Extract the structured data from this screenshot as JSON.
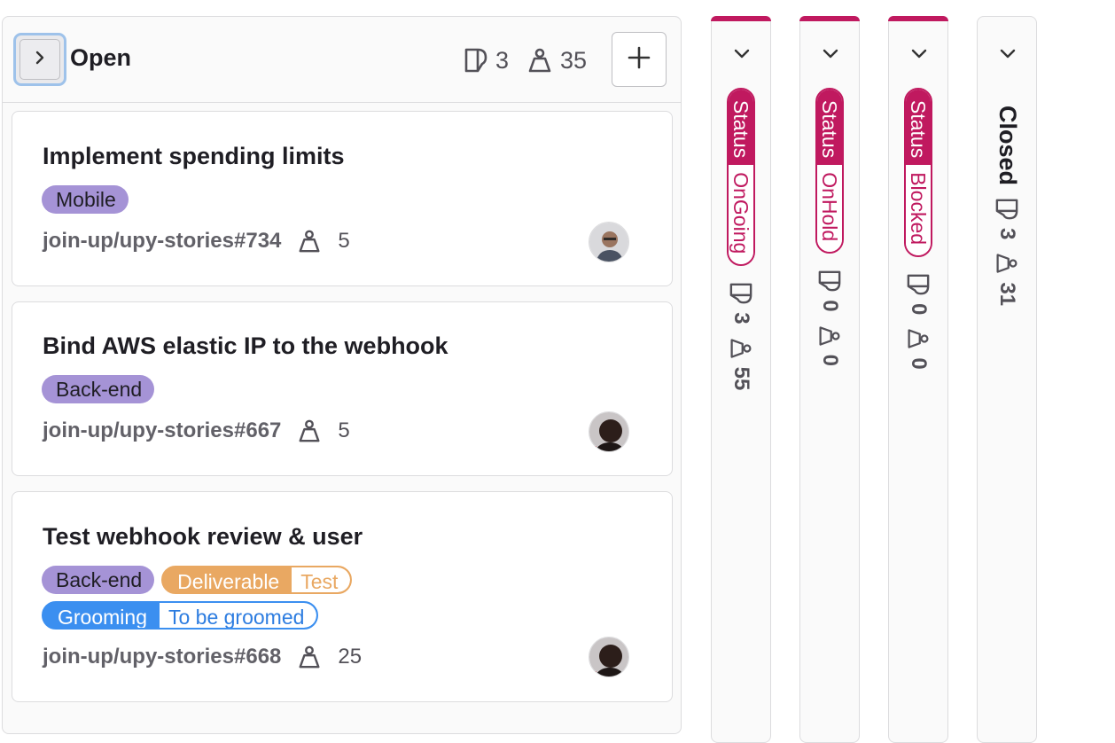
{
  "open_list": {
    "title": "Open",
    "issue_count": "3",
    "weight_total": "35",
    "cards": [
      {
        "title": "Implement spending limits",
        "labels": [
          {
            "text": "Mobile"
          }
        ],
        "reference": "join-up/upy-stories#734",
        "weight": "5"
      },
      {
        "title": "Bind AWS elastic IP to the webhook",
        "labels": [
          {
            "text": "Back-end"
          }
        ],
        "reference": "join-up/upy-stories#667",
        "weight": "5"
      },
      {
        "title": "Test webhook review & user",
        "labels": [
          {
            "text": "Back-end"
          },
          {
            "scope": "Deliverable",
            "value": "Test"
          },
          {
            "scope": "Grooming",
            "value": "To be groomed"
          }
        ],
        "reference": "join-up/upy-stories#668",
        "weight": "25"
      }
    ]
  },
  "collapsed_lists": [
    {
      "scope": "Status",
      "value": "OnGoing",
      "issue_count": "3",
      "weight_total": "55"
    },
    {
      "scope": "Status",
      "value": "OnHold",
      "issue_count": "0",
      "weight_total": "0"
    },
    {
      "scope": "Status",
      "value": "Blocked",
      "issue_count": "0",
      "weight_total": "0"
    },
    {
      "title": "Closed",
      "issue_count": "3",
      "weight_total": "31"
    }
  ],
  "colors": {
    "status_scope": "#c0195f",
    "label_mobile": "#a593d6",
    "label_backend": "#a593d6",
    "label_deliverable": "#e9a862",
    "label_grooming": "#3b8ff0"
  },
  "icons": [
    "chevron-right-icon",
    "issues-icon",
    "weight-icon",
    "plus-icon",
    "chevron-down-icon"
  ]
}
